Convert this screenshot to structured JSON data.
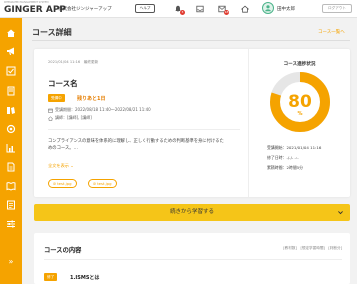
{
  "header": {
    "logo_tagline": "INTEGRATED MANAGEMENT SYSTEM",
    "logo_main": "GINGER APP",
    "company": "株式会社ジンジャーアップ",
    "help_label": "ヘルプ",
    "notifications_badge": "3",
    "messages_badge": "18",
    "user_name": "田中太郎",
    "logout_label": "ログアウト"
  },
  "sidebar": {
    "icons": [
      "home-icon",
      "megaphone-icon",
      "checklist-icon",
      "book-icon",
      "books-icon",
      "gear-check-icon",
      "chart-icon",
      "document-icon",
      "book-open-icon",
      "document-list-icon",
      "sliders-icon"
    ],
    "collapse_label": "»"
  },
  "page": {
    "title": "コース詳細",
    "back_link": "コース一覧へ"
  },
  "course": {
    "meta": "2021/01/04 11:16　最終更新",
    "name": "コース名",
    "status_badge": "受講中",
    "remaining": "残りあと1日",
    "period": "受講期間：2022/08/18 11:40〜2022/08/21 11:40",
    "instructor": "講師：[講師], [講師]",
    "description": "コンプライアンスの意味を体系的に理解し、正しく行動するための判断基準を身に付けるためのコース。…",
    "more_link": "全文を表示 ⌄",
    "files": [
      "test.jpg",
      "test.jpg"
    ]
  },
  "progress": {
    "title": "コース進捗状況",
    "value": 80,
    "unit": "%",
    "started": "受講開始：2021/01/04 11:16",
    "completed": "修了日時：-/-/- -:-",
    "duration": "累積時間：2時間5分"
  },
  "cta": {
    "label": "続きから学習する"
  },
  "contents": {
    "title": "コースの内容",
    "filters": "[教材数]　[想定学習時間]　[判断分]",
    "sections": [
      {
        "badge": "修了",
        "title": "1.ISMSとは"
      }
    ]
  },
  "colors": {
    "accent": "#f5a300",
    "cta": "#f5c518",
    "badge_red": "#e03a2f"
  }
}
